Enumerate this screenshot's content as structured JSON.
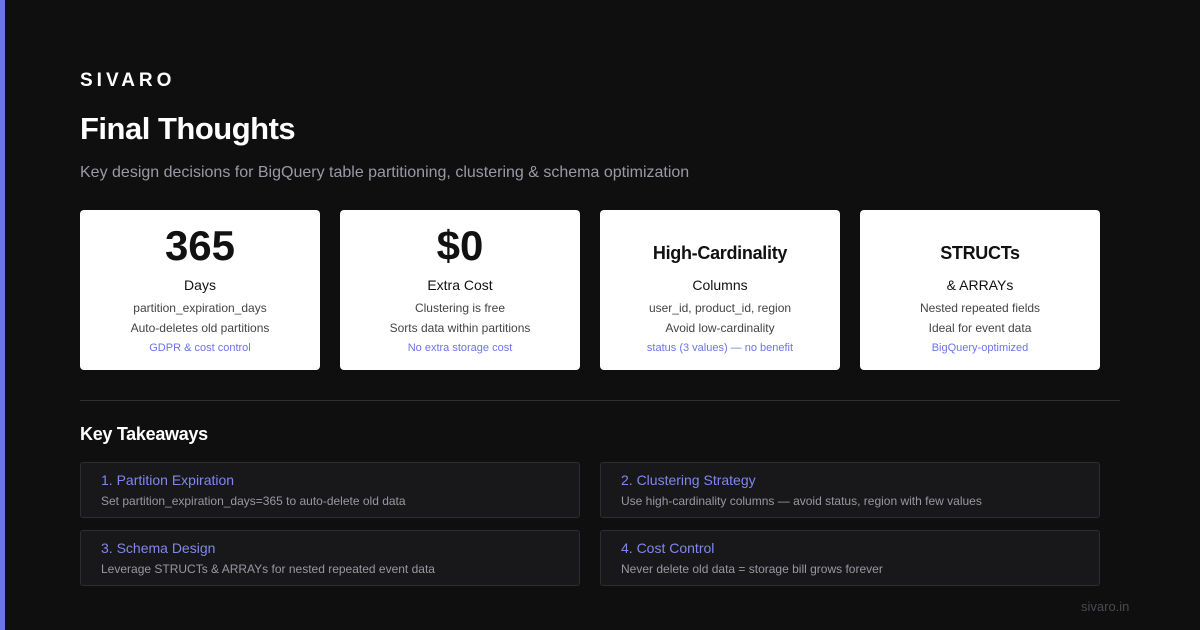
{
  "colors": {
    "background": "#0f0f10",
    "accent": "#6b74e8",
    "card_bg": "#ffffff",
    "panel_bg": "#18181b"
  },
  "brand": "SIVARO",
  "title": "Final Thoughts",
  "subtitle": "Key design decisions for BigQuery table partitioning, clustering & schema optimization",
  "cards": [
    {
      "value": "365",
      "label": "Days",
      "line1": "partition_expiration_days",
      "line2": "Auto-deletes old partitions",
      "note": "GDPR & cost control"
    },
    {
      "value": "$0",
      "label": "Extra Cost",
      "line1": "Clustering is free",
      "line2": "Sorts data within partitions",
      "note": "No extra storage cost"
    },
    {
      "value": "High-Cardinality",
      "label": "Columns",
      "line1": "user_id, product_id, region",
      "line2": "Avoid low-cardinality",
      "note": "status (3 values) — no benefit"
    },
    {
      "value": "STRUCTs",
      "label": "& ARRAYs",
      "line1": "Nested repeated fields",
      "line2": "Ideal for event data",
      "note": "BigQuery-optimized"
    }
  ],
  "takeaways_title": "Key Takeaways",
  "takeaways": [
    {
      "title": "1. Partition Expiration",
      "desc": "Set partition_expiration_days=365 to auto-delete old data"
    },
    {
      "title": "2. Clustering Strategy",
      "desc": "Use high-cardinality columns — avoid status, region with few values"
    },
    {
      "title": "3. Schema Design",
      "desc": "Leverage STRUCTs & ARRAYs for nested repeated event data"
    },
    {
      "title": "4. Cost Control",
      "desc": "Never delete old data = storage bill grows forever"
    }
  ],
  "footer": "sivaro.in"
}
